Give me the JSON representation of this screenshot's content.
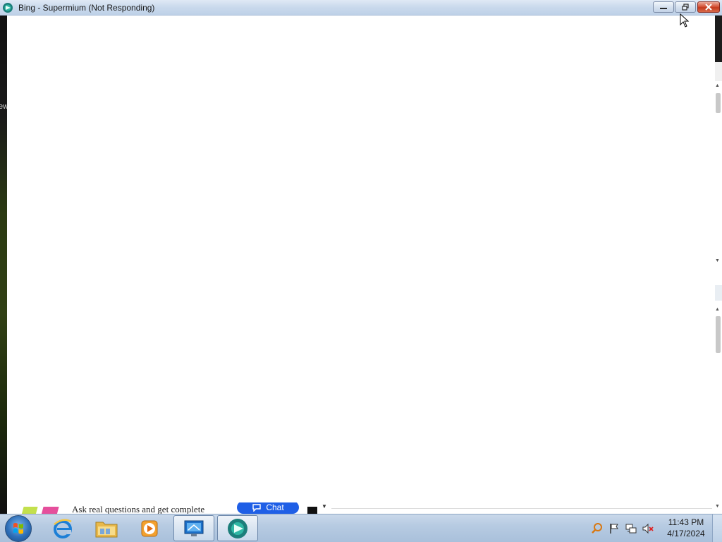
{
  "window": {
    "title": "Bing - Supermium (Not Responding)",
    "minimize_label": "minimize",
    "maximize_label": "restore",
    "close_label": "close"
  },
  "desktop": {
    "left_peek_text": "ew"
  },
  "page_peek": {
    "text": "Ask real questions and get complete",
    "chat_label": "Chat"
  },
  "taskbar": {
    "items": [
      {
        "name": "internet-explorer",
        "icon": "ie-icon"
      },
      {
        "name": "file-explorer",
        "icon": "folder-icon"
      },
      {
        "name": "media-player",
        "icon": "media-player-icon"
      },
      {
        "name": "remote-desktop",
        "icon": "remote-desktop-icon"
      },
      {
        "name": "supermium",
        "icon": "supermium-icon"
      }
    ],
    "clock": {
      "time": "11:43 PM",
      "date": "4/17/2024"
    }
  },
  "colors": {
    "titlebar": "#c9d9ec",
    "close_button": "#c43a1e",
    "taskbar": "#b7cbe2",
    "chat_button": "#1f5fe6"
  }
}
